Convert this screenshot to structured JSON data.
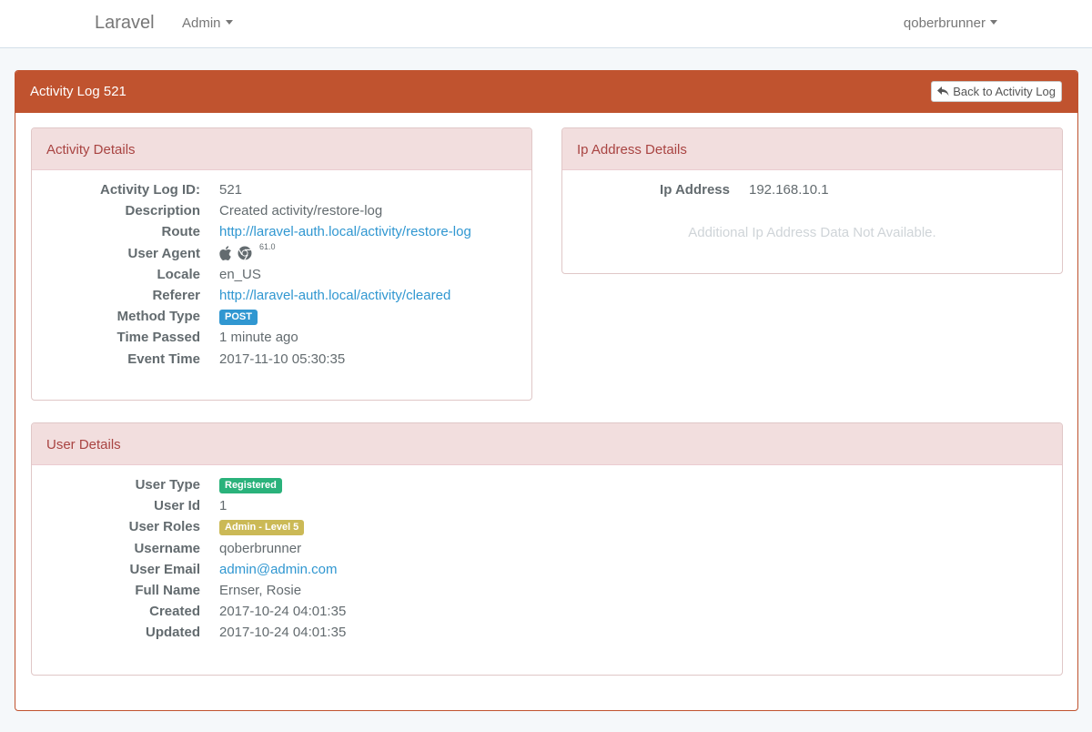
{
  "navbar": {
    "brand": "Laravel",
    "admin_menu": "Admin",
    "user_menu": "qoberbrunner"
  },
  "page": {
    "title": "Activity Log 521",
    "back_button": "Back to Activity Log"
  },
  "activity_details": {
    "title": "Activity Details",
    "rows": [
      {
        "label": "Activity Log ID:",
        "value": "521"
      },
      {
        "label": "Description",
        "value": "Created activity/restore-log"
      },
      {
        "label": "Route",
        "value": "http://laravel-auth.local/activity/restore-log"
      },
      {
        "label": "User Agent",
        "icons": [
          "apple-icon",
          "chrome-icon"
        ],
        "value": "61.0"
      },
      {
        "label": "Locale",
        "value": "en_US"
      },
      {
        "label": "Referer",
        "value": "http://laravel-auth.local/activity/cleared"
      },
      {
        "label": "Method Type",
        "value": "POST"
      },
      {
        "label": "Time Passed",
        "value": "1 minute ago"
      },
      {
        "label": "Event Time",
        "value": "2017-11-10 05:30:35"
      }
    ]
  },
  "ip_details": {
    "title": "Ip Address Details",
    "label": "Ip Address",
    "value": "192.168.10.1",
    "note": "Additional Ip Address Data Not Available."
  },
  "user_details": {
    "title": "User Details",
    "rows": [
      {
        "label": "User Type",
        "value": "Registered"
      },
      {
        "label": "User Id",
        "value": "1"
      },
      {
        "label": "User Roles",
        "value": "Admin - Level 5"
      },
      {
        "label": "Username",
        "value": "qoberbrunner"
      },
      {
        "label": "User Email",
        "value": "admin@admin.com"
      },
      {
        "label": "Full Name",
        "value": "Ernser, Rosie"
      },
      {
        "label": "Created",
        "value": "2017-10-24 04:01:35"
      },
      {
        "label": "Updated",
        "value": "2017-10-24 04:01:35"
      }
    ]
  },
  "colors": {
    "primary_header": "#c0532f",
    "sub_header": "#f2dede",
    "sub_title": "#a94442",
    "link": "#3097d1",
    "label_post": "#3097d1",
    "label_registered": "#2ab27b",
    "label_admin": "#cbb956"
  }
}
